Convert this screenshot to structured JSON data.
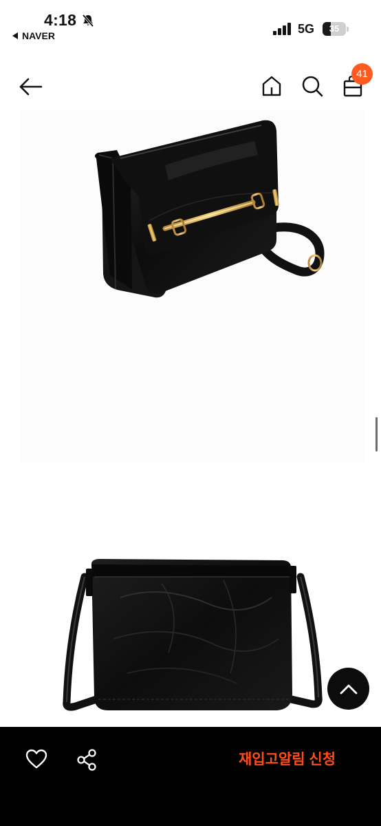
{
  "status_bar": {
    "time": "4:18",
    "back_app_label": "NAVER",
    "network": "5G",
    "battery_level": "35",
    "battery_fraction": 0.35
  },
  "header": {
    "cart_count": "41",
    "icons": [
      "back-arrow-icon",
      "home-icon",
      "search-icon",
      "cart-icon"
    ]
  },
  "product_images": [
    "bag-front-view",
    "bag-back-view"
  ],
  "bottom_bar": {
    "restock_label": "재입고알림 신청",
    "icons": [
      "heart-icon",
      "share-icon"
    ]
  },
  "colors": {
    "accent": "#ff5a1f",
    "restock_text": "#ff4d1a",
    "bottom_bar": "#000000"
  }
}
